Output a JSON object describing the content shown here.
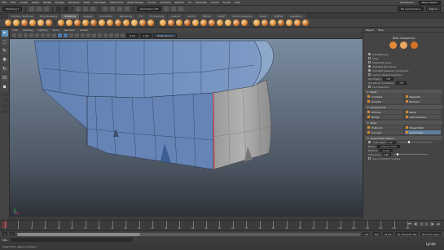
{
  "menubar": {
    "items": [
      "File",
      "Edit",
      "Create",
      "Select",
      "Modify",
      "Display",
      "Windows",
      "Mesh",
      "Edit Mesh",
      "Mesh Tools",
      "Mesh Display",
      "Curves",
      "Surfaces",
      "Deform",
      "UV",
      "Generate",
      "Cache",
      "Arnold",
      "Help"
    ],
    "workspace_label": "Workspace :",
    "workspace_value": "Maya Classic"
  },
  "statusline": {
    "mode": "Modeling",
    "symmetry_label": "Symmetry: Off",
    "no_live": "No Live Surface",
    "signin": "Sign In"
  },
  "shelf_tabs": [
    {
      "label": "Curves / Surfaces",
      "active": false
    },
    {
      "label": "Poly Modeling",
      "active": false
    },
    {
      "label": "Sculpting",
      "active": true
    },
    {
      "label": "Rigging",
      "active": false
    },
    {
      "label": "Animation",
      "active": false
    },
    {
      "label": "Rendering",
      "active": false
    },
    {
      "label": "FX",
      "active": false
    },
    {
      "label": "FX Caching",
      "active": false
    },
    {
      "label": "Custom",
      "active": false
    },
    {
      "label": "Arnold",
      "active": false
    },
    {
      "label": "Bifrost",
      "active": false
    },
    {
      "label": "MASH",
      "active": false
    },
    {
      "label": "Motion Graphics",
      "active": false
    },
    {
      "label": "XGen",
      "active": false
    },
    {
      "label": "TURTLE",
      "active": false
    },
    {
      "label": "GameExp",
      "active": false
    }
  ],
  "shelf_icon_colors": [
    "#d9822b",
    "#e49a3a",
    "#c86c24",
    "#d98a2c",
    "#e2a24a",
    "#cc7429",
    "#d9822b",
    "#e49a3a",
    "#c86c24",
    "#d98a2c",
    "#b85f20",
    "#e49a3a",
    "#d9822b",
    "#c86c24",
    "#d98a2c",
    "#e2a24a",
    "#cc7429",
    "#d9822b",
    "#e49a3a",
    "#c86c24",
    "#d98a2c",
    "#b85f20",
    "#e49a3a",
    "#d9822b",
    "#c86c24",
    "#d98a2c",
    "#e2a24a",
    "#cc7429",
    "#d9822b",
    "#e49a3a",
    "#c86c24",
    "#d98a2c",
    "#b85f20",
    "#e49a3a",
    "#d9822b",
    "#c86c24"
  ],
  "toolbox": [
    {
      "name": "select-tool-icon",
      "glyph": "➤",
      "active": true
    },
    {
      "name": "lasso-tool-icon",
      "glyph": "◌",
      "active": false
    },
    {
      "name": "paint-select-icon",
      "glyph": "✎",
      "active": false
    },
    {
      "name": "move-tool-icon",
      "glyph": "✥",
      "active": false
    },
    {
      "name": "rotate-tool-icon",
      "glyph": "↻",
      "active": false
    },
    {
      "name": "scale-tool-icon",
      "glyph": "⊡",
      "active": false
    },
    {
      "name": "last-tool-icon",
      "glyph": "▪",
      "active": false
    }
  ],
  "view_menu": [
    "View",
    "Shading",
    "Lighting",
    "Show",
    "Renderer",
    "Panels"
  ],
  "viewport": {
    "camera_label": "",
    "gamma_label": "sRGB gamma",
    "exposure": "0.00",
    "gamma": "1.00"
  },
  "right_panel": {
    "menu": [
      "Object",
      "Help"
    ],
    "title": "Multi-Component",
    "options": [
      {
        "label": "Pick/Marquee",
        "checked": true
      },
      {
        "label": "Drag",
        "checked": false
      },
      {
        "label": "Tweak/Marquee",
        "checked": false
      },
      {
        "label": "Highlight Backfaces",
        "checked": true
      },
      {
        "label": "Highlight Nearest Component",
        "checked": true
      }
    ],
    "falloff_label": "Camera Based Selection",
    "symmetry_label": "Symmetry:",
    "symmetry_value": "Off",
    "transform_label": "Transform Constraint:",
    "transform_value": "Off",
    "tool_defaults": "Tool Defaults",
    "soft_label": "Soft Selection",
    "mesh_section": "Mesh",
    "mesh_buttons": [
      {
        "label": "Combine",
        "on": false
      },
      {
        "label": "Separate",
        "on": false
      },
      {
        "label": "Smooth",
        "on": false
      },
      {
        "label": "Boolean",
        "on": false
      }
    ],
    "components_section": "Components",
    "component_buttons": [
      {
        "label": "Extrude",
        "on": false
      },
      {
        "label": "Bevel",
        "on": false
      },
      {
        "label": "Bridge",
        "on": false
      },
      {
        "label": "Add Divisions",
        "on": false
      }
    ],
    "tools_section": "Tools",
    "tool_buttons": [
      {
        "label": "Multi-Cut",
        "on": false
      },
      {
        "label": "Target Weld",
        "on": false
      },
      {
        "label": "Connect",
        "on": false
      },
      {
        "label": "Quad Draw",
        "on": true
      }
    ],
    "quad_section": "Quad Draw Options",
    "auto_weld_label": "Auto weld",
    "auto_weld_value": "0.0",
    "auto_weld_level": 0.3,
    "relax_label": "Relax:",
    "relax_value": "Interior verts",
    "extend_label": "Extend:",
    "extend_value": "Loops",
    "loop_label": "Auto weld",
    "loop_value": "0.00",
    "loop_level": 0.1,
    "constraint_label": "Use Constraint Surface"
  },
  "timeline": {
    "ticks": [
      "1",
      "4",
      "8",
      "12",
      "16",
      "20",
      "24",
      "28",
      "32",
      "36",
      "40",
      "44",
      "48",
      "52",
      "56",
      "60",
      "64",
      "68",
      "72",
      "76",
      "80",
      "84",
      "88",
      "92",
      "96",
      "100",
      "104",
      "108",
      "112",
      "116",
      "120"
    ],
    "current_frame": "1"
  },
  "range": {
    "start": "1",
    "inner_start": "1",
    "inner_end": "120",
    "end": "120",
    "end2": "200",
    "fps": "24 fps",
    "character": "No Character Set",
    "anim_layer": "No Anim Layer"
  },
  "cmdline": {
    "mel": "MEL"
  },
  "helpline": {
    "text": "Select Tool: select an object"
  },
  "watermark": "Lynda"
}
